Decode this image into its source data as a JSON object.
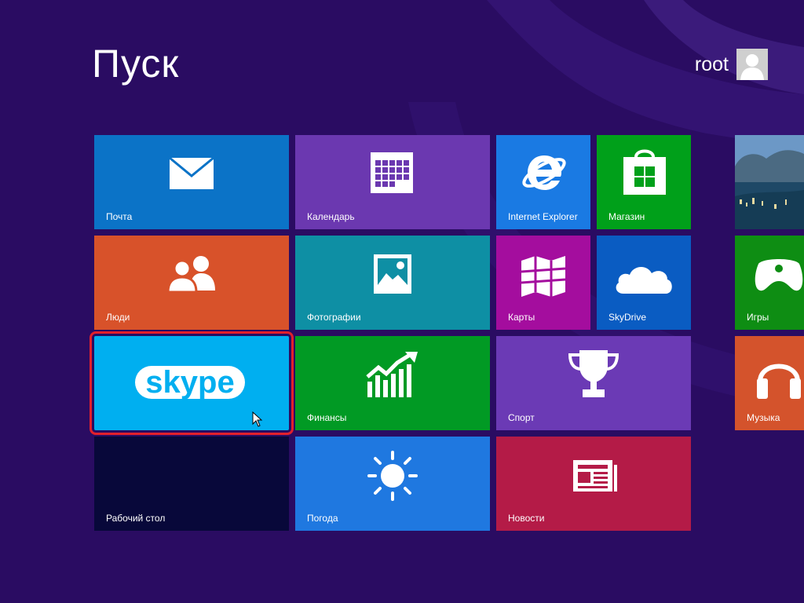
{
  "screen": {
    "title": "Пуск"
  },
  "user": {
    "name": "root"
  },
  "tiles": {
    "mail": {
      "label": "Почта",
      "color": "#0b73c7",
      "icon": "envelope-icon"
    },
    "calendar": {
      "label": "Календарь",
      "color": "#6b38b0",
      "icon": "calendar-icon"
    },
    "ie": {
      "label": "Internet Explorer",
      "color": "#1a7ae3",
      "icon": "internet-explorer-icon"
    },
    "store": {
      "label": "Магазин",
      "color": "#00a01a",
      "icon": "store-bag-icon"
    },
    "photos": {
      "label": "",
      "color": "#356c8e",
      "icon": "landscape-photo"
    },
    "people": {
      "label": "Люди",
      "color": "#d8522a",
      "icon": "people-icon"
    },
    "pictures": {
      "label": "Фотографии",
      "color": "#0e8fa4",
      "icon": "picture-icon"
    },
    "maps": {
      "label": "Карты",
      "color": "#a40d9e",
      "icon": "map-icon"
    },
    "skydrive": {
      "label": "SkyDrive",
      "color": "#0a5cc2",
      "icon": "cloud-icon"
    },
    "games": {
      "label": "Игры",
      "color": "#0e8d13",
      "icon": "gamepad-icon"
    },
    "skype": {
      "label": "",
      "color": "#00aff0",
      "icon": "skype-logo",
      "logo_text": "skype"
    },
    "finance": {
      "label": "Финансы",
      "color": "#019a24",
      "icon": "finance-chart-icon"
    },
    "sport": {
      "label": "Спорт",
      "color": "#6b3ab5",
      "icon": "trophy-icon"
    },
    "music": {
      "label": "Музыка",
      "color": "#d4532c",
      "icon": "headphones-icon"
    },
    "desktop": {
      "label": "Рабочий стол",
      "color": "#08083a",
      "icon": ""
    },
    "weather": {
      "label": "Погода",
      "color": "#1f78e0",
      "icon": "sun-icon"
    },
    "news": {
      "label": "Новости",
      "color": "#b41b47",
      "icon": "newspaper-icon"
    }
  },
  "colors": {
    "background": "#2a0c62",
    "selection": "#e2202c"
  }
}
